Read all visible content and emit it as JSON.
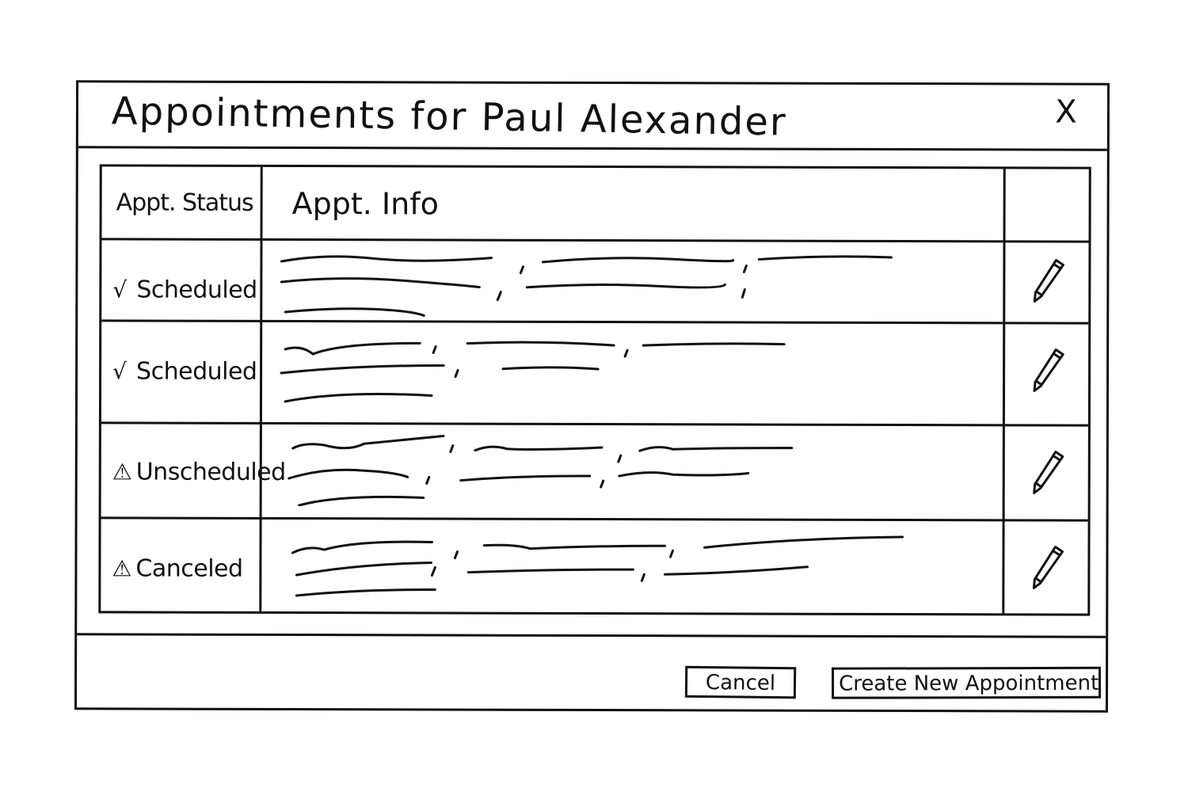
{
  "dialog": {
    "title": "Appointments for Paul Alexander",
    "close_label": "X"
  },
  "table": {
    "headers": {
      "status": "Appt. Status",
      "info": "Appt. Info"
    },
    "rows": [
      {
        "status_icon": "check-icon",
        "status_mark": "√",
        "status": "Scheduled"
      },
      {
        "status_icon": "check-icon",
        "status_mark": "√",
        "status": "Scheduled"
      },
      {
        "status_icon": "warning-icon",
        "status_mark": "⚠",
        "status": "Unscheduled"
      },
      {
        "status_icon": "warning-icon",
        "status_mark": "⚠",
        "status": "Canceled"
      }
    ],
    "edit_icon": "pencil-icon"
  },
  "footer": {
    "cancel_label": "Cancel",
    "create_label": "Create New Appointment"
  }
}
